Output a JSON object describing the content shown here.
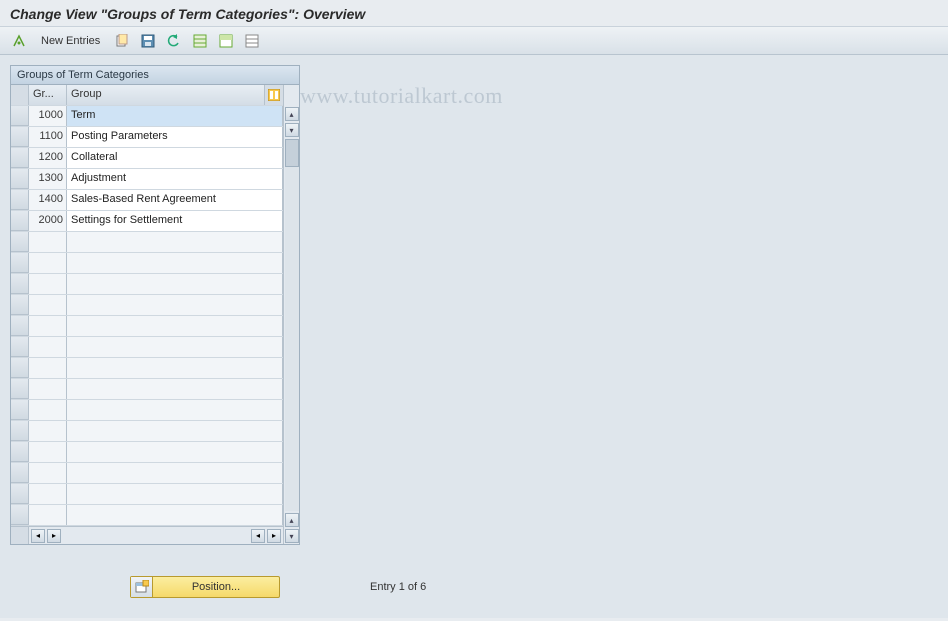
{
  "title": "Change View \"Groups of Term Categories\": Overview",
  "toolbar": {
    "new_entries_label": "New Entries"
  },
  "panel": {
    "title": "Groups of Term Categories",
    "columns": {
      "code": "Gr...",
      "name": "Group"
    },
    "rows": [
      {
        "code": "1000",
        "name": "Term",
        "selected": true
      },
      {
        "code": "1100",
        "name": "Posting Parameters"
      },
      {
        "code": "1200",
        "name": "Collateral"
      },
      {
        "code": "1300",
        "name": "Adjustment"
      },
      {
        "code": "1400",
        "name": "Sales-Based Rent Agreement"
      },
      {
        "code": "2000",
        "name": "Settings for Settlement"
      }
    ],
    "empty_rows": 14
  },
  "footer": {
    "position_label": "Position...",
    "entry_text": "Entry 1 of 6"
  },
  "watermark": "www.tutorialkart.com"
}
